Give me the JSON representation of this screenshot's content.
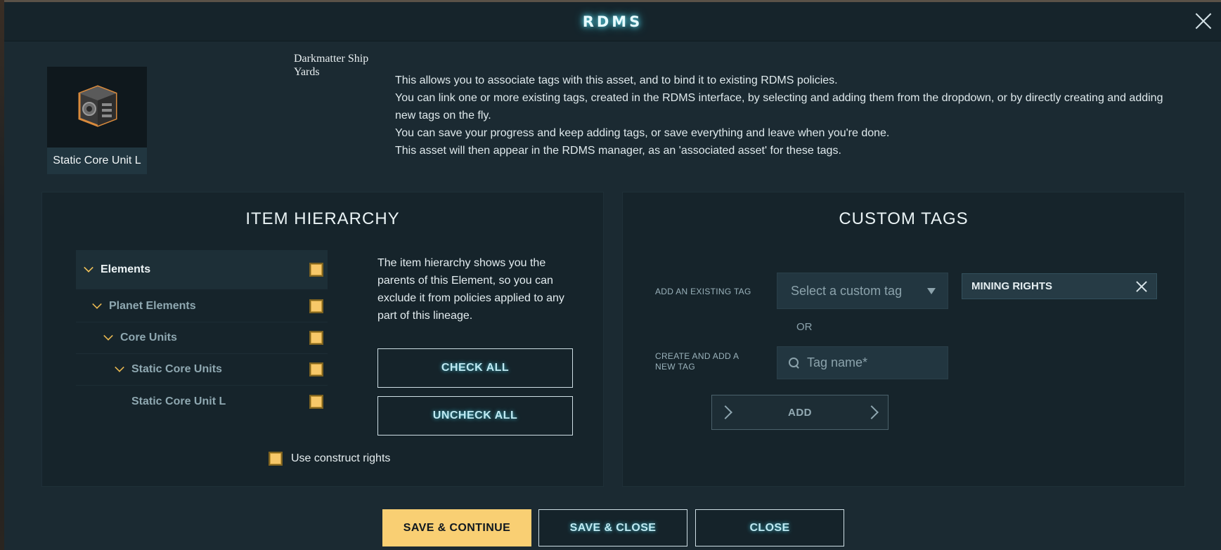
{
  "window": {
    "title": "RDMS",
    "close_icon": "close-icon"
  },
  "item": {
    "name": "Static Core Unit L",
    "owner": "Darkmatter Ship Yards",
    "image_icon": "core-unit-cube-icon"
  },
  "description": [
    "This allows you to associate tags with this asset, and to bind it to existing RDMS policies.",
    "You can link one or more existing tags, created in the RDMS interface, by selecting and adding them from the dropdown, or by directly creating and adding new tags on the fly.",
    "You can save your progress and keep adding tags, or save everything and leave when you're done.",
    "This asset will then appear in the RDMS manager, as an 'associated asset' for these tags."
  ],
  "hierarchy": {
    "title": "ITEM HIERARCHY",
    "items": [
      {
        "label": "Elements",
        "checked": true
      },
      {
        "label": "Planet Elements",
        "checked": true
      },
      {
        "label": "Core Units",
        "checked": true
      },
      {
        "label": "Static Core Units",
        "checked": true
      },
      {
        "label": "Static Core Unit L",
        "checked": true
      }
    ],
    "info": "The item hierarchy shows you the parents of this Element, so you can exclude it from policies applied to any part of this lineage.",
    "check_all_label": "CHECK ALL",
    "uncheck_all_label": "UNCHECK ALL",
    "construct_rights_label": "Use construct rights",
    "construct_rights_checked": true
  },
  "custom_tags": {
    "title": "CUSTOM TAGS",
    "add_existing_label": "ADD AN EXISTING TAG",
    "select_placeholder": "Select a custom tag",
    "selected_tags": [
      "MINING RIGHTS"
    ],
    "or_label": "OR",
    "create_label": "CREATE AND ADD A NEW TAG",
    "tag_name_placeholder": "Tag name*",
    "add_label": "ADD"
  },
  "footer": {
    "save_continue_label": "SAVE & CONTINUE",
    "save_close_label": "SAVE & CLOSE",
    "close_label": "CLOSE"
  },
  "colors": {
    "accent_gold": "#f9cf73",
    "panel_bg": "#16242b",
    "window_bg": "#1b2a32",
    "title_glow": "#5fd6e8"
  }
}
